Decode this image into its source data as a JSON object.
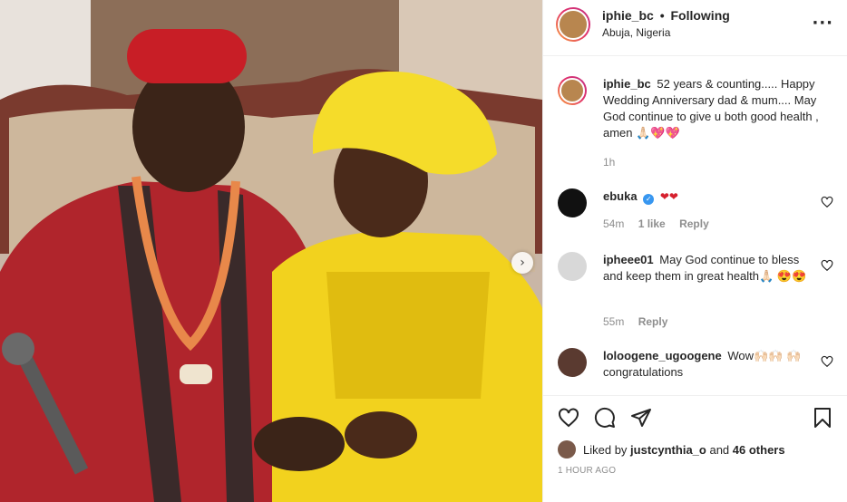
{
  "post": {
    "username": "iphie_bc",
    "dot": "•",
    "follow_status": "Following",
    "location": "Abuja, Nigeria",
    "more_icon": "more-horizontal-icon"
  },
  "photo": {
    "next_icon": "chevron-right-icon",
    "next_glyph": "›",
    "colors": {
      "background_red": "#8a2a30",
      "yellow_outfit": "#f2d21e",
      "red_cap": "#c81e26"
    }
  },
  "caption": {
    "username": "iphie_bc",
    "text": "52 years & counting..... Happy Wedding Anniversary dad & mum.... May God continue to give u both good health , amen 🙏🏻💖💖",
    "time": "1h"
  },
  "comments": [
    {
      "username": "ebuka",
      "verified": true,
      "text": "❤❤",
      "time": "54m",
      "likes": "1 like",
      "reply": "Reply"
    },
    {
      "username": "ipheee01",
      "verified": false,
      "text": "May God continue to bless and keep them in great health🙏🏻 😍😍",
      "time": "55m",
      "reply": "Reply"
    },
    {
      "username": "loloogene_ugoogene",
      "verified": false,
      "text": "Wow🙌🏻🙌🏻 🙌🏻congratulations"
    }
  ],
  "actions": {
    "like_icon": "heart-icon",
    "comment_icon": "comment-icon",
    "share_icon": "share-icon",
    "save_icon": "bookmark-icon"
  },
  "likes": {
    "prefix": "Liked by ",
    "user": "justcynthia_o",
    "middle": " and ",
    "others": "46 others"
  },
  "timestamp": "1 hour ago",
  "accent_color": "#3897f0"
}
